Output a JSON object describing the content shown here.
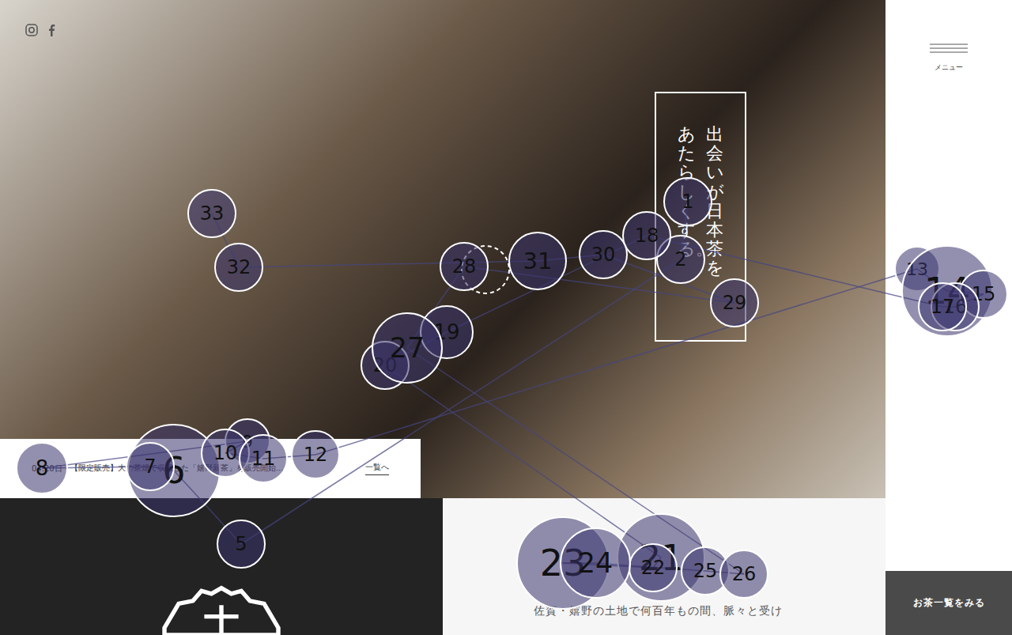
{
  "hero": {
    "tagline": [
      "出会いが日本茶を",
      "あたらしくする。"
    ]
  },
  "sidebar": {
    "menu_label": "メニュー",
    "cta": "お茶一覧をみる"
  },
  "news": {
    "date": "04.20日",
    "headline": "【限定販売】大の茶畑で収穫した「嬉野新茶」を販売開始…",
    "more": "一覧へ"
  },
  "intro": {
    "text": "佐賀・嬉野の土地で何百年もの間、脈々と受け"
  },
  "nodes": [
    {
      "label": "1",
      "kind": "solid"
    },
    {
      "label": "2",
      "kind": "solid"
    },
    {
      "label": "",
      "kind": "dashed"
    },
    {
      "label": "5",
      "kind": "solid"
    },
    {
      "label": "6",
      "kind": "solid"
    },
    {
      "label": "7",
      "kind": "solid"
    },
    {
      "label": "8",
      "kind": "solid"
    },
    {
      "label": "9",
      "kind": "solid"
    },
    {
      "label": "10",
      "kind": "solid"
    },
    {
      "label": "11",
      "kind": "solid"
    },
    {
      "label": "12",
      "kind": "solid"
    },
    {
      "label": "13",
      "kind": "solid"
    },
    {
      "label": "14",
      "kind": "solid"
    },
    {
      "label": "15",
      "kind": "solid"
    },
    {
      "label": "16",
      "kind": "solid"
    },
    {
      "label": "17",
      "kind": "solid"
    },
    {
      "label": "18",
      "kind": "solid"
    },
    {
      "label": "19",
      "kind": "solid"
    },
    {
      "label": "20",
      "kind": "solid"
    },
    {
      "label": "21",
      "kind": "solid"
    },
    {
      "label": "22",
      "kind": "solid"
    },
    {
      "label": "23",
      "kind": "solid"
    },
    {
      "label": "24",
      "kind": "solid"
    },
    {
      "label": "25",
      "kind": "solid"
    },
    {
      "label": "26",
      "kind": "solid"
    },
    {
      "label": "27",
      "kind": "solid"
    },
    {
      "label": "28",
      "kind": "solid"
    },
    {
      "label": "29",
      "kind": "solid"
    },
    {
      "label": "30",
      "kind": "solid"
    },
    {
      "label": "31",
      "kind": "solid"
    },
    {
      "label": "32",
      "kind": "solid"
    },
    {
      "label": "33",
      "kind": "solid"
    }
  ]
}
